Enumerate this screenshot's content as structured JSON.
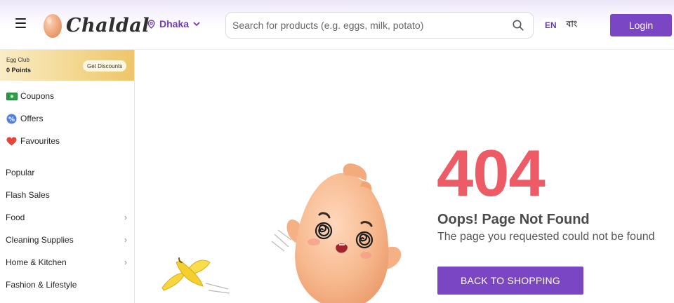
{
  "header": {
    "brand": "Chaldal",
    "location": "Dhaka",
    "search_placeholder": "Search for products (e.g. eggs, milk, potato)",
    "lang_en": "EN",
    "lang_bn": "বাং",
    "login_label": "Login",
    "accent_color": "#7b46c4"
  },
  "sidebar": {
    "egg_club": {
      "title": "Egg Club",
      "points": "0 Points",
      "button": "Get Discounts"
    },
    "promo_items": [
      {
        "label": "Coupons",
        "icon": "coupon-icon"
      },
      {
        "label": "Offers",
        "icon": "offer-badge-icon"
      },
      {
        "label": "Favourites",
        "icon": "heart-icon"
      }
    ],
    "categories": [
      {
        "label": "Popular",
        "has_children": false
      },
      {
        "label": "Flash Sales",
        "has_children": false
      },
      {
        "label": "Food",
        "has_children": true
      },
      {
        "label": "Cleaning Supplies",
        "has_children": true
      },
      {
        "label": "Home & Kitchen",
        "has_children": true
      },
      {
        "label": "Fashion & Lifestyle",
        "has_children": false
      }
    ]
  },
  "error_page": {
    "code": "404",
    "title": "Oops! Page Not Found",
    "message": "The page you requested could not be found",
    "button_label": "BACK TO SHOPPING",
    "code_color": "#ec5b66"
  }
}
